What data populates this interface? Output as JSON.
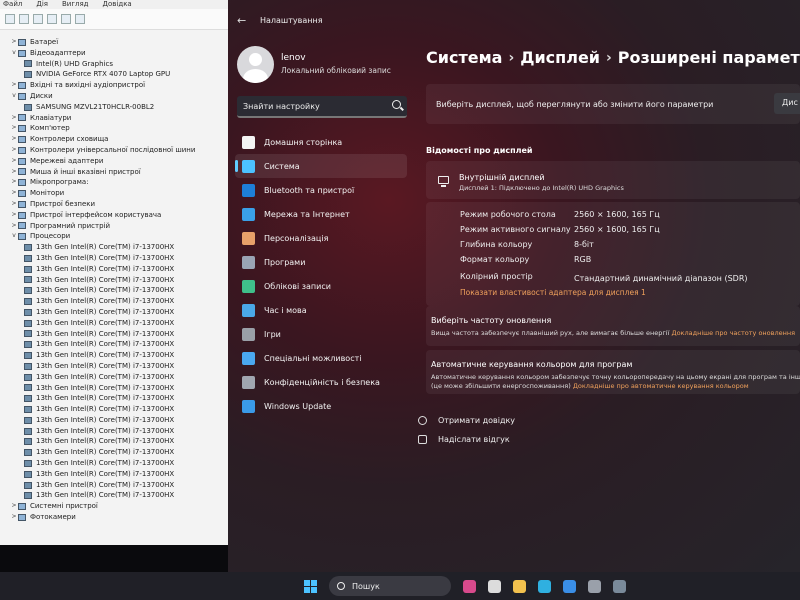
{
  "device_manager": {
    "menu": [
      "Файл",
      "Дія",
      "Вигляд",
      "Довідка"
    ],
    "tree": [
      {
        "label": "Батареї",
        "level": 0,
        "expander": ">"
      },
      {
        "label": "Відеоадаптери",
        "level": 0,
        "expander": "v"
      },
      {
        "label": "Intel(R) UHD Graphics",
        "level": 1
      },
      {
        "label": "NVIDIA GeForce RTX 4070 Laptop GPU",
        "level": 1
      },
      {
        "label": "Вхідні та вихідні аудіопристрої",
        "level": 0,
        "expander": ">"
      },
      {
        "label": "Диски",
        "level": 0,
        "expander": "v"
      },
      {
        "label": "SAMSUNG MZVL21T0HCLR-00BL2",
        "level": 1
      },
      {
        "label": "Клавіатури",
        "level": 0,
        "expander": ">"
      },
      {
        "label": "Комп'ютер",
        "level": 0,
        "expander": ">"
      },
      {
        "label": "Контролери сховища",
        "level": 0,
        "expander": ">"
      },
      {
        "label": "Контролери універсальної послідовної шини",
        "level": 0,
        "expander": ">"
      },
      {
        "label": "Мережеві адаптери",
        "level": 0,
        "expander": ">"
      },
      {
        "label": "Миша й інші вказівні пристрої",
        "level": 0,
        "expander": ">"
      },
      {
        "label": "Мікропрограма:",
        "level": 0,
        "expander": ">"
      },
      {
        "label": "Монітори",
        "level": 0,
        "expander": ">"
      },
      {
        "label": "Пристрої безпеки",
        "level": 0,
        "expander": ">"
      },
      {
        "label": "Пристрої інтерфейсом користувача",
        "level": 0,
        "expander": ">"
      },
      {
        "label": "Програмний пристрій",
        "level": 0,
        "expander": ">"
      },
      {
        "label": "Процесори",
        "level": 0,
        "expander": "v"
      },
      {
        "label": "13th Gen Intel(R) Core(TM) i7-13700HX",
        "level": 1
      },
      {
        "label": "13th Gen Intel(R) Core(TM) i7-13700HX",
        "level": 1
      },
      {
        "label": "13th Gen Intel(R) Core(TM) i7-13700HX",
        "level": 1
      },
      {
        "label": "13th Gen Intel(R) Core(TM) i7-13700HX",
        "level": 1
      },
      {
        "label": "13th Gen Intel(R) Core(TM) i7-13700HX",
        "level": 1
      },
      {
        "label": "13th Gen Intel(R) Core(TM) i7-13700HX",
        "level": 1
      },
      {
        "label": "13th Gen Intel(R) Core(TM) i7-13700HX",
        "level": 1
      },
      {
        "label": "13th Gen Intel(R) Core(TM) i7-13700HX",
        "level": 1
      },
      {
        "label": "13th Gen Intel(R) Core(TM) i7-13700HX",
        "level": 1
      },
      {
        "label": "13th Gen Intel(R) Core(TM) i7-13700HX",
        "level": 1
      },
      {
        "label": "13th Gen Intel(R) Core(TM) i7-13700HX",
        "level": 1
      },
      {
        "label": "13th Gen Intel(R) Core(TM) i7-13700HX",
        "level": 1
      },
      {
        "label": "13th Gen Intel(R) Core(TM) i7-13700HX",
        "level": 1
      },
      {
        "label": "13th Gen Intel(R) Core(TM) i7-13700HX",
        "level": 1
      },
      {
        "label": "13th Gen Intel(R) Core(TM) i7-13700HX",
        "level": 1
      },
      {
        "label": "13th Gen Intel(R) Core(TM) i7-13700HX",
        "level": 1
      },
      {
        "label": "13th Gen Intel(R) Core(TM) i7-13700HX",
        "level": 1
      },
      {
        "label": "13th Gen Intel(R) Core(TM) i7-13700HX",
        "level": 1
      },
      {
        "label": "13th Gen Intel(R) Core(TM) i7-13700HX",
        "level": 1
      },
      {
        "label": "13th Gen Intel(R) Core(TM) i7-13700HX",
        "level": 1
      },
      {
        "label": "13th Gen Intel(R) Core(TM) i7-13700HX",
        "level": 1
      },
      {
        "label": "13th Gen Intel(R) Core(TM) i7-13700HX",
        "level": 1
      },
      {
        "label": "13th Gen Intel(R) Core(TM) i7-13700HX",
        "level": 1
      },
      {
        "label": "13th Gen Intel(R) Core(TM) i7-13700HX",
        "level": 1
      },
      {
        "label": "Системні пристрої",
        "level": 0,
        "expander": ">"
      },
      {
        "label": "Фотокамери",
        "level": 0,
        "expander": ">"
      }
    ]
  },
  "settings": {
    "window_title": "Налаштування",
    "user": {
      "name": "lenov",
      "account_type": "Локальний обліковий запис"
    },
    "search_placeholder": "Знайти настройку",
    "nav": [
      {
        "label": "Домашня сторінка",
        "icon": "home-icon",
        "color": "#f4f4f4"
      },
      {
        "label": "Система",
        "icon": "system-icon",
        "color": "#4cc2ff",
        "active": true
      },
      {
        "label": "Bluetooth та пристрої",
        "icon": "bluetooth-icon",
        "color": "#1e7fd8"
      },
      {
        "label": "Мережа та Інтернет",
        "icon": "wifi-icon",
        "color": "#3aa0e8"
      },
      {
        "label": "Персоналізація",
        "icon": "brush-icon",
        "color": "#e8a16a"
      },
      {
        "label": "Програми",
        "icon": "apps-icon",
        "color": "#9aa4b4"
      },
      {
        "label": "Облікові записи",
        "icon": "accounts-icon",
        "color": "#3fbf8a"
      },
      {
        "label": "Час і мова",
        "icon": "time-language-icon",
        "color": "#4aa8e8"
      },
      {
        "label": "Ігри",
        "icon": "gaming-icon",
        "color": "#9aa0a8"
      },
      {
        "label": "Спеціальні можливості",
        "icon": "accessibility-icon",
        "color": "#4aa8f0"
      },
      {
        "label": "Конфіденційність і безпека",
        "icon": "shield-icon",
        "color": "#a0a6b0"
      },
      {
        "label": "Windows Update",
        "icon": "update-icon",
        "color": "#3a9ae8"
      }
    ],
    "breadcrumb": [
      "Система",
      "Дисплей",
      "Розширені параметри е"
    ],
    "breadcrumb_sep": "›",
    "selector": {
      "text": "Виберіть дисплей, щоб переглянути або змінити його параметри",
      "dropdown_value": "Дис"
    },
    "display_info": {
      "section_title": "Відомості про дисплей",
      "display_name": "Внутрішній дисплей",
      "display_sub": "Дисплей 1: Підключено до Intel(R) UHD Graphics",
      "properties": [
        {
          "label": "Режим робочого стола",
          "value": "2560 × 1600, 165 Гц"
        },
        {
          "label": "Режим активного сигналу",
          "value": "2560 × 1600, 165 Гц"
        },
        {
          "label": "Глибина кольору",
          "value": "8-біт"
        },
        {
          "label": "Формат кольору",
          "value": "RGB"
        },
        {
          "label": "Колірний простір",
          "value": "Стандартний динамічний діапазон (SDR)"
        }
      ],
      "adapter_link": "Показати властивості адаптера для дисплея 1"
    },
    "refresh_rate": {
      "title": "Виберіть частоту оновлення",
      "desc": "Вища частота забезпечує плавніший рух, але вимагає більше енергії",
      "link": "Докладніше про частоту оновлення"
    },
    "color_mgmt": {
      "title": "Автоматичне керування кольором для програм",
      "desc1": "Автоматичне керування кольором забезпечує точну кольоропередачу на цьому екрані для програм та іншого",
      "desc2": "(це може збільшити енергоспоживання)",
      "link": "Докладніше про автоматичне керування кольором"
    },
    "footer_links": [
      "Отримати довідку",
      "Надіслати відгук"
    ]
  },
  "taskbar": {
    "search_label": "Пошук",
    "apps": [
      {
        "icon": "pen-icon",
        "color": "#d84a8c"
      },
      {
        "icon": "task-view-icon",
        "color": "#dcdcdc"
      },
      {
        "icon": "file-explorer-icon",
        "color": "#f2c14e"
      },
      {
        "icon": "edge-icon",
        "color": "#2fb0e0"
      },
      {
        "icon": "store-icon",
        "color": "#3a8ee6"
      },
      {
        "icon": "settings-icon",
        "color": "#9aa0aa"
      },
      {
        "icon": "device-manager-icon",
        "color": "#7a8a9a"
      }
    ]
  }
}
